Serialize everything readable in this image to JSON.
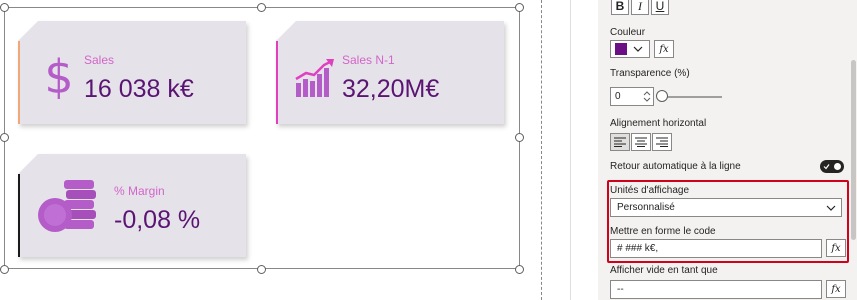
{
  "cards": [
    {
      "label": "Sales",
      "value": "16 038 k€",
      "icon": "dollar-icon",
      "accent_color": "#f0a77a"
    },
    {
      "label": "Sales N-1",
      "value": "32,20M€",
      "icon": "growth-chart-icon",
      "accent_color": "#e040c0"
    },
    {
      "label": "% Margin",
      "value": "-0,08 %",
      "icon": "coins-icon",
      "accent_color": "#1a1a1a"
    }
  ],
  "colors": {
    "card_bg": "#e6e2ea",
    "label": "#d166c8",
    "value": "#5a1472",
    "icon": "#b45cc8",
    "highlight_border": "#d0021b",
    "font_color_swatch": "#6b0f85"
  },
  "format_pane": {
    "text_style_buttons": [
      "B",
      "I",
      "U"
    ],
    "color_label": "Couleur",
    "transparency_label": "Transparence (%)",
    "transparency_value": "0",
    "transparency_level": 0,
    "alignment_label": "Alignement horizontal",
    "alignment_options": [
      "left",
      "center",
      "right"
    ],
    "alignment_selected": "left",
    "word_wrap_label": "Retour automatique à la ligne",
    "word_wrap_on": true,
    "display_units_label": "Unités d'affichage",
    "display_units_value": "Personnalisé",
    "format_code_label": "Mettre en forme le code",
    "format_code_value": "# ### k€,",
    "show_blank_label": "Afficher vide en tant que",
    "show_blank_value": "--",
    "fx_label": "fx"
  }
}
